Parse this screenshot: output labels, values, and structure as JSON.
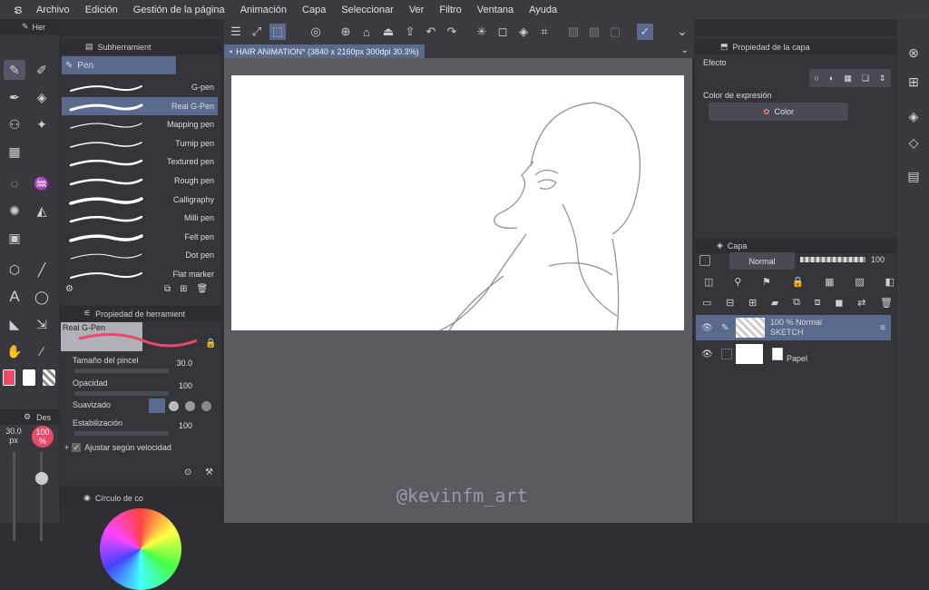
{
  "menu": [
    "Archivo",
    "Edición",
    "Gestión de la página",
    "Animación",
    "Capa",
    "Seleccionar",
    "Ver",
    "Filtro",
    "Ventana",
    "Ayuda"
  ],
  "tool_panel_tab": "Her",
  "subtool": {
    "title": "Subherramient",
    "group": "Pen",
    "brushes": [
      "G-pen",
      "Real G-Pen",
      "Mapping pen",
      "Turnip pen",
      "Textured pen",
      "Rough pen",
      "Calligraphy",
      "Milli pen",
      "Felt pen",
      "Dot pen",
      "Flat marker"
    ],
    "selected_index": 1
  },
  "tool_property": {
    "title": "Propiedad de herramient",
    "preview_label": "Real G-Pen",
    "brush_size_label": "Tamaño del pincel",
    "brush_size": "30.0",
    "opacity_label": "Opacidad",
    "opacity": "100",
    "smoothing_label": "Suavizado",
    "stabilization_label": "Estabilización",
    "stabilization": "100",
    "adjust_label": "Ajustar según velocidad"
  },
  "left_sizes": {
    "size": "30.0\npx",
    "size_num": "30.0",
    "size_unit": "px",
    "opacity": "100\n%",
    "opacity_num": "100",
    "opacity_unit": "%",
    "des_tab": "Des"
  },
  "color_circle_tab": "Círculo de co",
  "document_tab": "HAIR ANIMATION* (3840 x 2160px 300dpi 30.3%)",
  "layer_property": {
    "title": "Propiedad de la capa",
    "effect_label": "Efecto",
    "expression_label": "Color de expresión",
    "expression_value": "Color"
  },
  "layers_panel": {
    "title": "Capa",
    "blend_mode": "Normal",
    "opacity": "100",
    "layers": [
      {
        "name": "SKETCH",
        "info": "100 %  Normal",
        "selected": true
      },
      {
        "name": "Papel",
        "info": "",
        "selected": false
      }
    ]
  },
  "watermark": "@kevinfm_art",
  "colors": {
    "main": "#e84a6a",
    "sub": "#ffffff",
    "accent": "#5a6a8c"
  }
}
